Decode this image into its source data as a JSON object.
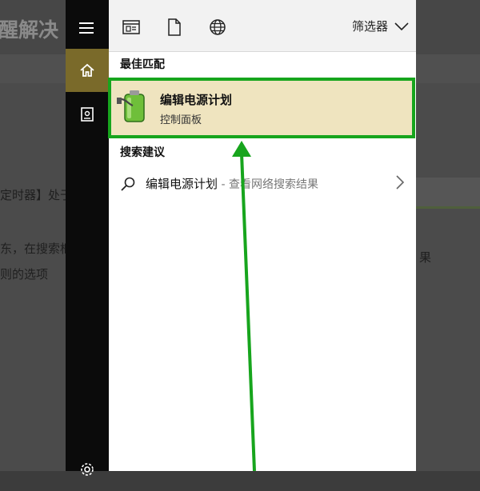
{
  "background": {
    "title_fragment": "醒解决",
    "text_fragments": [
      "定时器】处于",
      "东，在搜索框",
      "则的选项",
      "果"
    ]
  },
  "rail": {
    "items": [
      {
        "icon": "hamburger-menu-icon"
      },
      {
        "icon": "home-icon"
      },
      {
        "icon": "notebook-icon"
      },
      {
        "icon": "settings-icon"
      }
    ]
  },
  "toolbar": {
    "icons": [
      "apps-icon",
      "document-icon",
      "globe-icon"
    ],
    "filter_label": "筛选器"
  },
  "best_match": {
    "header": "最佳匹配",
    "title": "编辑电源计划",
    "subtitle": "控制面板",
    "icon": "power-plan-battery-icon"
  },
  "suggestions": {
    "header": "搜索建议",
    "items": [
      {
        "query": "编辑电源计划",
        "suffix": " - 查看网络搜索结果"
      }
    ]
  },
  "colors": {
    "highlight_border": "#17a51d",
    "best_match_bg": "#efe4bf",
    "active_rail": "#7a6a2a",
    "arrow": "#17a51d"
  }
}
